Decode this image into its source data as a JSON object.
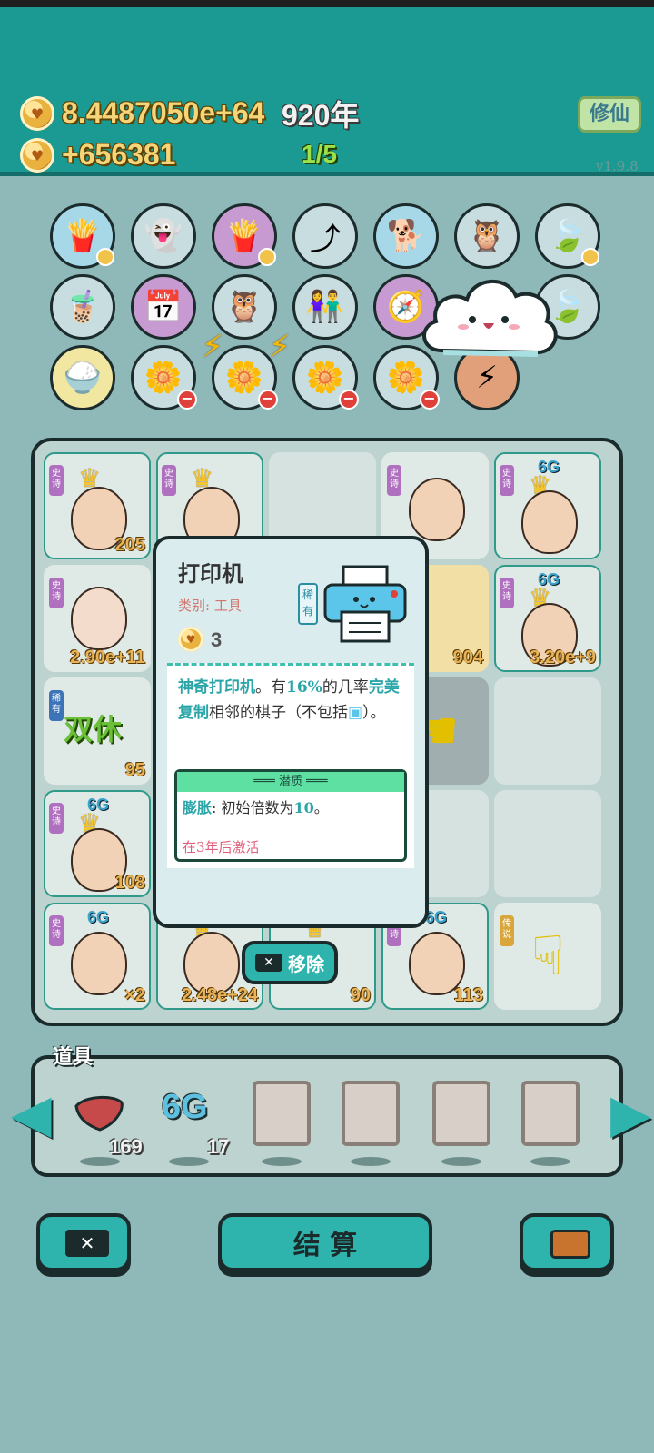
{
  "hud": {
    "coins": "8.4487050e+64",
    "year": "920年",
    "income": "+656381",
    "progress": "1/5",
    "xiuxian_label": "修仙",
    "version": "v1.9.8"
  },
  "board_cells": [
    {
      "tag": "史诗",
      "num": "205"
    },
    {
      "tag": "史诗",
      "num": ""
    },
    {
      "tag": "",
      "num": ""
    },
    {
      "tag": "史诗",
      "num": ""
    },
    {
      "tag": "史诗",
      "level": "6G",
      "num": ""
    },
    {
      "tag": "史诗",
      "num": "2.90e+11"
    },
    {
      "num": "904"
    },
    {
      "tag": "史诗",
      "level": "6G",
      "num": "3.20e+9"
    },
    {
      "tag": "稀有",
      "label": "双休",
      "num": "95"
    },
    {
      "tag": "史诗",
      "level": "6G",
      "num": "108"
    },
    {
      "tag": "史诗",
      "level": "6G",
      "num": "×2"
    },
    {
      "num": "2.48e+24"
    },
    {
      "num": "90"
    },
    {
      "tag": "史诗",
      "level": "6G",
      "num": "113"
    },
    {
      "tag": "传说",
      "num": ""
    }
  ],
  "popup": {
    "title": "打印机",
    "category": "类别: 工具",
    "rarity": "稀有",
    "cost": "3",
    "desc_part1": "神奇打印机",
    "desc_part2": "。有",
    "desc_part3": "16%",
    "desc_part4": "的几率",
    "desc_part5": "完美复制",
    "desc_part6": "相邻的棋子（不包括",
    "desc_part7": "）。",
    "trait_header": "═══ 潜质 ═══",
    "trait_name": "膨胀",
    "trait_text": ": 初始倍数为",
    "trait_value": "10",
    "trait_end": "。",
    "activate_text": "在3年后激活"
  },
  "remove_label": "移除",
  "tools": {
    "label": "道具",
    "item1_count": "169",
    "item2_label": "6G",
    "item2_count": "17"
  },
  "settle_label": "结 算",
  "colors": {
    "header": "#1b9a93",
    "accent": "#2fb3ad",
    "gold_text": "#f5d47a"
  }
}
